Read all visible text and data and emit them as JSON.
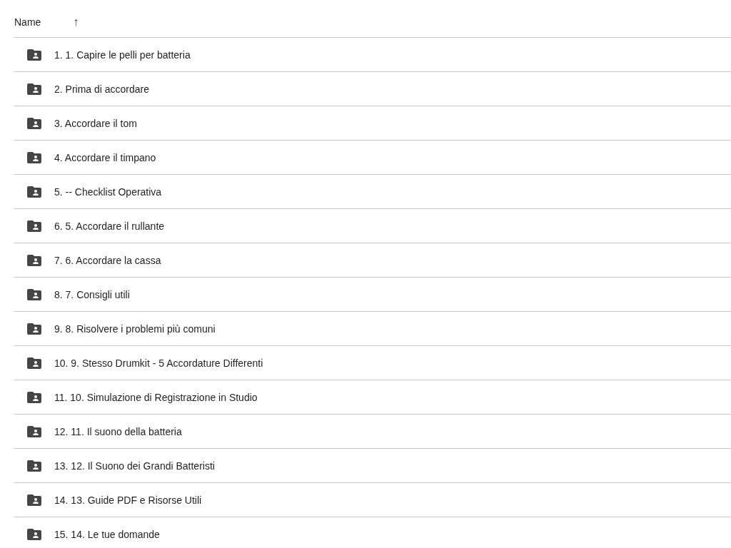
{
  "header": {
    "column": "Name",
    "sort_icon": "↑"
  },
  "rows": [
    {
      "name": "1. 1. Capire le pelli per batteria"
    },
    {
      "name": "2. Prima di accordare"
    },
    {
      "name": "3. Accordare il tom"
    },
    {
      "name": "4. Accordare il timpano"
    },
    {
      "name": "5. -- Checklist Operativa"
    },
    {
      "name": "6. 5. Accordare il rullante"
    },
    {
      "name": "7. 6. Accordare la cassa"
    },
    {
      "name": "8. 7. Consigli utili"
    },
    {
      "name": "9. 8. Risolvere i problemi più comuni"
    },
    {
      "name": "10. 9. Stesso Drumkit - 5 Accordature Differenti"
    },
    {
      "name": "11. 10. Simulazione di Registrazione in Studio"
    },
    {
      "name": "12. 11. Il suono della batteria"
    },
    {
      "name": "13. 12. Il Suono dei Grandi Batteristi"
    },
    {
      "name": "14. 13. Guide PDF e Risorse Utili"
    },
    {
      "name": "15. 14. Le tue domande"
    }
  ]
}
